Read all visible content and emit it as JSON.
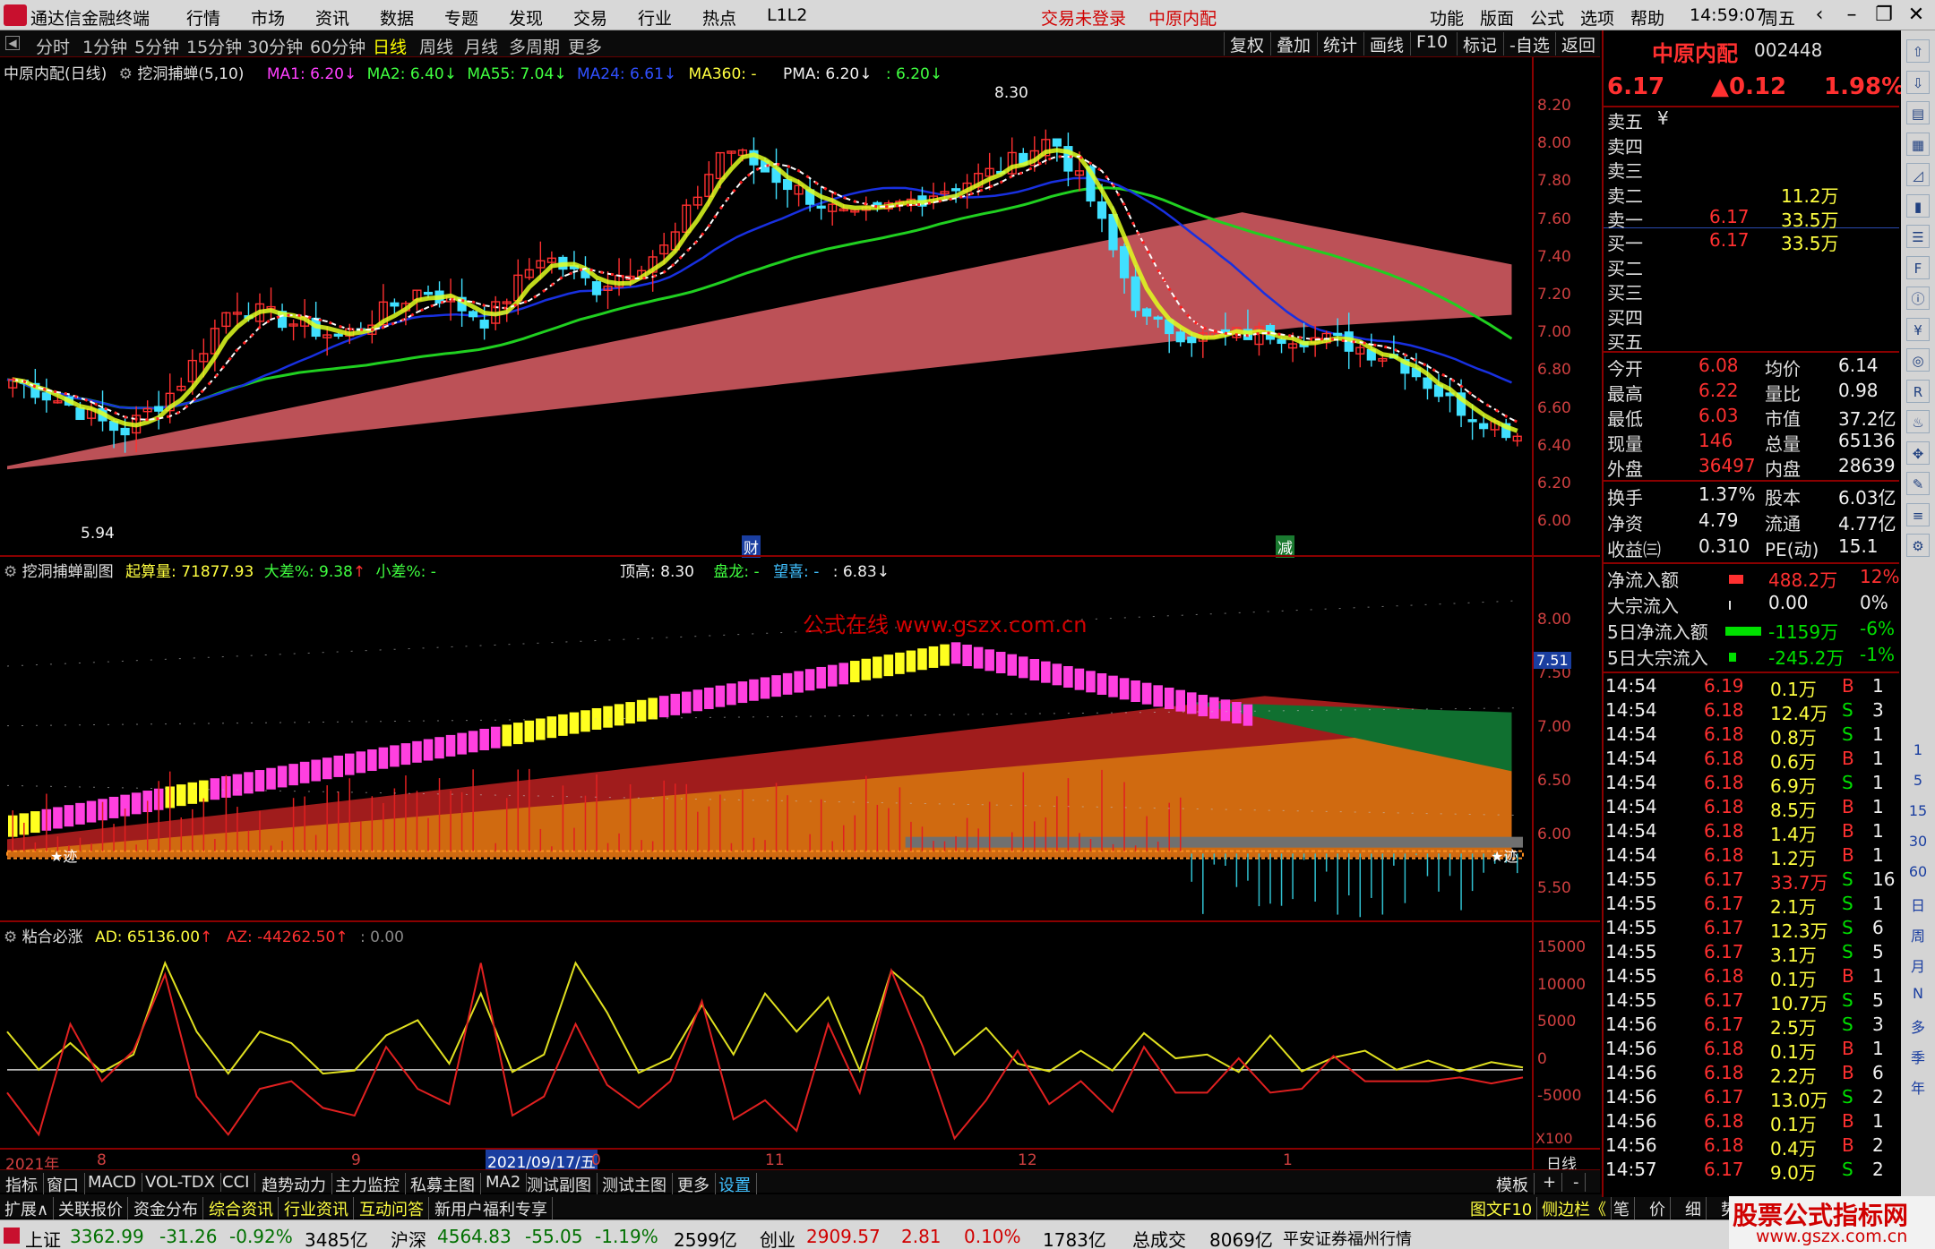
{
  "topbar": {
    "app_title": "通达信金融终端",
    "menus": [
      "行情",
      "市场",
      "资讯",
      "数据",
      "专题",
      "发现",
      "交易",
      "行业",
      "热点",
      "L1L2"
    ],
    "warn1": "交易未登录",
    "warn2": "中原内配",
    "right_menus": [
      "功能",
      "版面",
      "公式",
      "选项",
      "帮助"
    ],
    "clock": "14:59:07",
    "weekday": "周五"
  },
  "periods": [
    "分时",
    "1分钟",
    "5分钟",
    "15分钟",
    "30分钟",
    "60分钟",
    "日线",
    "周线",
    "月线",
    "多周期",
    "更多"
  ],
  "active_period": "日线",
  "right_tools": [
    "复权",
    "叠加",
    "统计",
    "画线",
    "F10",
    "标记",
    "-自选",
    "返回"
  ],
  "main_chart": {
    "stock_label": "中原内配(日线)",
    "indicator": "挖洞捕蝉(5,10)",
    "ma1": "MA1: 6.20",
    "ma2": "MA2: 6.40",
    "ma55": "MA55: 7.04",
    "ma24": "MA24: 6.61",
    "ma360": "MA360: -",
    "pma": "PMA: 6.20",
    "pma2": ": 6.20",
    "y_ticks": [
      "8.20",
      "8.00",
      "7.80",
      "7.60",
      "7.40",
      "7.20",
      "7.00",
      "6.80",
      "6.60",
      "6.40",
      "6.20",
      "6.00"
    ],
    "high_label": "8.30",
    "low_label": "5.94",
    "marker1": "财",
    "marker2": "减"
  },
  "sub1": {
    "name": "挖洞捕蝉副图",
    "qisuan": "起算量: 71877.93",
    "dacha": "大差%: 9.38",
    "xiaocha": "小差%: -",
    "dinggao": "顶高: 8.30",
    "panlong": "盘龙: -",
    "wangxi": "望喜: -",
    "val": ": 6.83",
    "watermark": "公式在线 www.gszx.com.cn",
    "y_ticks": [
      "8.00",
      "7.50",
      "7.00",
      "6.50",
      "6.00",
      "5.50"
    ],
    "current_tag": "7.51",
    "star_left": "★迹",
    "star_right": "★迹"
  },
  "sub2": {
    "name": "粘合必涨",
    "ad": "AD: 65136.00",
    "az": "AZ: -44262.50",
    "extra": ": 0.00",
    "y_ticks": [
      "15000",
      "10000",
      "5000",
      "0",
      "-5000"
    ],
    "x100": "X100"
  },
  "time_axis": {
    "labels": [
      "2021年",
      "8",
      "9",
      "2021/09/17/五",
      "0",
      "11",
      "12",
      "1"
    ],
    "right": "日线"
  },
  "bottom_tabs1": [
    "指标",
    "窗口",
    "MACD",
    "VOL-TDX",
    "CCI",
    "趋势动力",
    "主力监控",
    "私募主图",
    "MA2",
    "测试副图",
    "测试主图",
    "更多",
    "设置"
  ],
  "bottom_tabs1_right": [
    "模板",
    "+",
    "-"
  ],
  "bottom_tabs2": [
    "扩展∧",
    "关联报价",
    "资金分布",
    "综合资讯",
    "行业资讯",
    "互动问答",
    "新用户福利专享"
  ],
  "bottom_tabs2_right": [
    "图文F10",
    "侧边栏《",
    "笔",
    "价",
    "细",
    "势"
  ],
  "quote": {
    "name": "中原内配",
    "code": "002448",
    "price": "6.17",
    "change": "▲0.12",
    "pct": "1.98%",
    "sell": [
      {
        "label": "卖五",
        "price": "",
        "vol": "",
        "flag": "¥"
      },
      {
        "label": "卖四",
        "price": "",
        "vol": ""
      },
      {
        "label": "卖三",
        "price": "",
        "vol": ""
      },
      {
        "label": "卖二",
        "price": "",
        "vol": "11.2万"
      },
      {
        "label": "卖一",
        "price": "6.17",
        "vol": "33.5万"
      }
    ],
    "buy": [
      {
        "label": "买一",
        "price": "6.17",
        "vol": "33.5万"
      },
      {
        "label": "买二",
        "price": "",
        "vol": ""
      },
      {
        "label": "买三",
        "price": "",
        "vol": ""
      },
      {
        "label": "买四",
        "price": "",
        "vol": ""
      },
      {
        "label": "买五",
        "price": "",
        "vol": ""
      }
    ],
    "stats": [
      {
        "l1": "今开",
        "v1": "6.08",
        "l2": "均价",
        "v2": "6.14"
      },
      {
        "l1": "最高",
        "v1": "6.22",
        "l2": "量比",
        "v2": "0.98"
      },
      {
        "l1": "最低",
        "v1": "6.03",
        "l2": "市值",
        "v2": "37.2亿"
      },
      {
        "l1": "现量",
        "v1": "146",
        "l2": "总量",
        "v2": "65136"
      },
      {
        "l1": "外盘",
        "v1": "36497",
        "l2": "内盘",
        "v2": "28639"
      }
    ],
    "stats2": [
      {
        "l1": "换手",
        "v1": "1.37%",
        "l2": "股本",
        "v2": "6.03亿"
      },
      {
        "l1": "净资",
        "v1": "4.79",
        "l2": "流通",
        "v2": "4.77亿"
      },
      {
        "l1": "收益㈢",
        "v1": "0.310",
        "l2": "PE(动)",
        "v2": "15.1"
      }
    ],
    "flows": [
      {
        "label": "净流入额",
        "val": "488.2万",
        "pct": "12%"
      },
      {
        "label": "大宗流入",
        "val": "0.00",
        "pct": "0%"
      },
      {
        "label": "5日净流入额",
        "val": "-1159万",
        "pct": "-6%"
      },
      {
        "label": "5日大宗流入",
        "val": "-245.2万",
        "pct": "-1%"
      }
    ],
    "ticks": [
      [
        "14:54",
        "6.19",
        "0.1万",
        "B",
        "1"
      ],
      [
        "14:54",
        "6.18",
        "12.4万",
        "S",
        "3"
      ],
      [
        "14:54",
        "6.18",
        "0.8万",
        "S",
        "1"
      ],
      [
        "14:54",
        "6.18",
        "0.6万",
        "B",
        "1"
      ],
      [
        "14:54",
        "6.18",
        "6.9万",
        "S",
        "1"
      ],
      [
        "14:54",
        "6.18",
        "8.5万",
        "B",
        "1"
      ],
      [
        "14:54",
        "6.18",
        "1.4万",
        "B",
        "1"
      ],
      [
        "14:54",
        "6.18",
        "1.2万",
        "B",
        "1"
      ],
      [
        "14:55",
        "6.17",
        "33.7万",
        "S",
        "16"
      ],
      [
        "14:55",
        "6.17",
        "2.1万",
        "S",
        "1"
      ],
      [
        "14:55",
        "6.17",
        "12.3万",
        "S",
        "6"
      ],
      [
        "14:55",
        "6.17",
        "3.1万",
        "S",
        "5"
      ],
      [
        "14:55",
        "6.18",
        "0.1万",
        "B",
        "1"
      ],
      [
        "14:55",
        "6.17",
        "10.7万",
        "S",
        "5"
      ],
      [
        "14:56",
        "6.17",
        "2.5万",
        "S",
        "3"
      ],
      [
        "14:56",
        "6.18",
        "0.1万",
        "B",
        "1"
      ],
      [
        "14:56",
        "6.18",
        "2.2万",
        "B",
        "6"
      ],
      [
        "14:56",
        "6.17",
        "13.0万",
        "S",
        "2"
      ],
      [
        "14:56",
        "6.18",
        "0.1万",
        "B",
        "1"
      ],
      [
        "14:56",
        "6.18",
        "0.4万",
        "B",
        "2"
      ],
      [
        "14:57",
        "6.17",
        "9.0万",
        "S",
        "2"
      ]
    ]
  },
  "side_icons": [
    "up-arrow",
    "down-arrow",
    "book",
    "grid",
    "chart",
    "candle",
    "list",
    "f10",
    "info",
    "fin",
    "eye",
    "rsi",
    "flame",
    "move",
    "pen",
    "fs",
    "gear"
  ],
  "side_texts": [
    "1",
    "5",
    "15",
    "30",
    "60",
    "日",
    "周",
    "月",
    "N",
    "多",
    "季",
    "年"
  ],
  "status": {
    "sh_name": "上证",
    "sh_val": "3362.99",
    "sh_chg": "-31.26",
    "sh_pct": "-0.92%",
    "sh_amt": "3485亿",
    "hs_name": "沪深",
    "hs_val": "4564.83",
    "hs_chg": "-55.05",
    "hs_pct": "-1.19%",
    "hs_amt": "2599亿",
    "cy_name": "创业",
    "cy_val": "2909.57",
    "cy_chg": "2.81",
    "cy_pct": "0.10%",
    "cy_amt": "1783亿",
    "total_label": "总成交",
    "total_val": "8069亿",
    "broker": "平安证券福州行情"
  },
  "site_watermark": {
    "line1": "股票公式指标网",
    "line2": "www.gszx.com.cn"
  },
  "colors": {
    "up": "#ff3030",
    "down": "#00e000",
    "axis": "#d04040",
    "yellow": "#ffff40",
    "cyan": "#40c0ff"
  }
}
